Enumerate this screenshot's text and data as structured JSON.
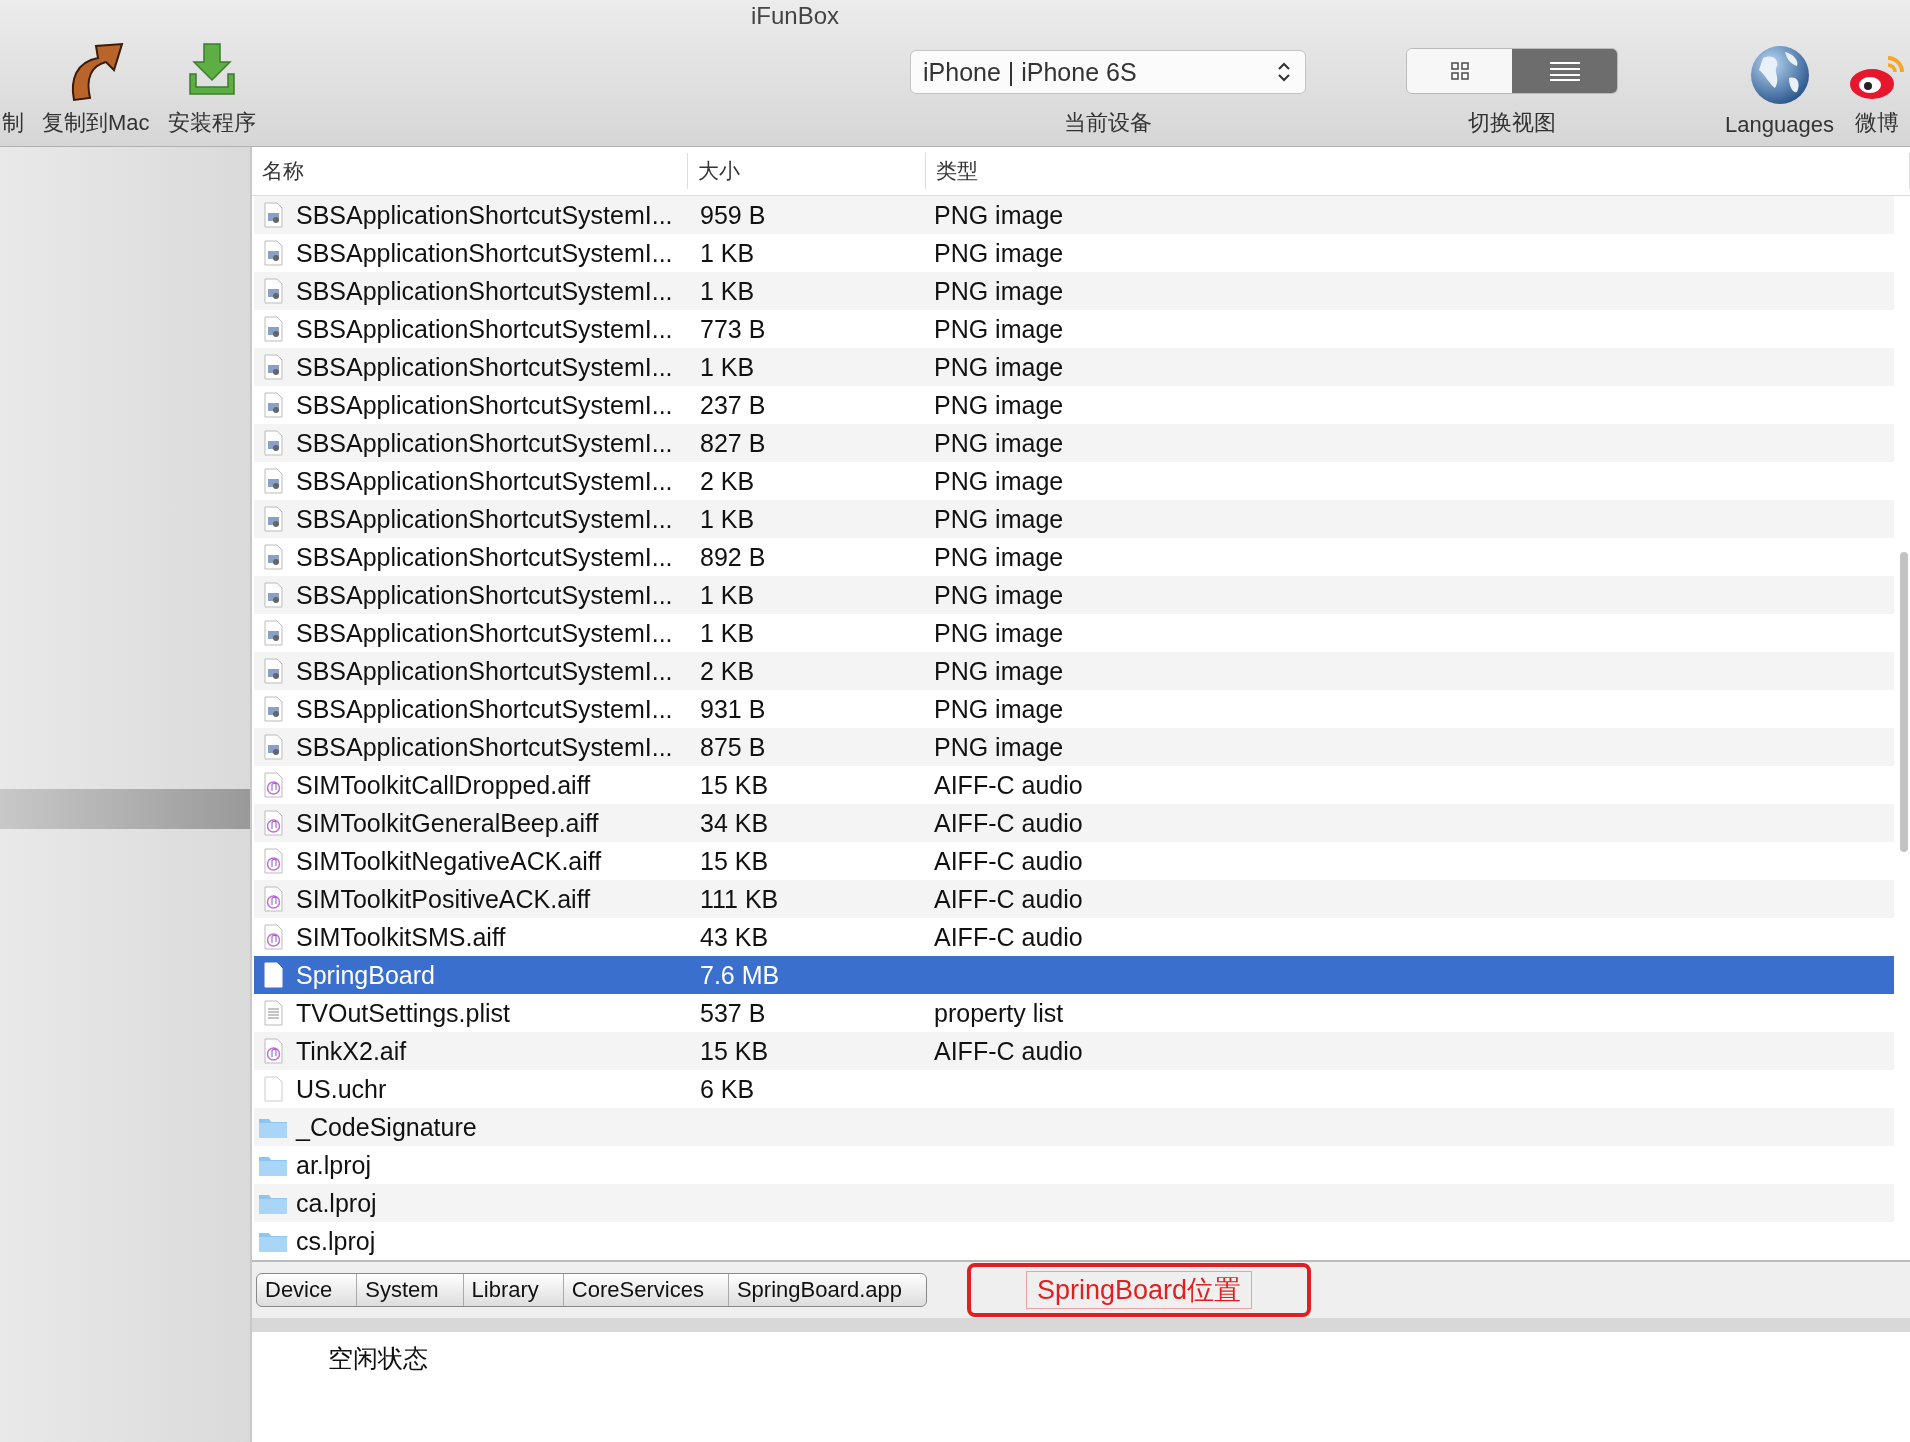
{
  "window": {
    "title": "iFunBox"
  },
  "toolbar": {
    "left_items": [
      {
        "label": "制",
        "kind": "text"
      },
      {
        "label": "复制到Mac",
        "kind": "arrow"
      },
      {
        "label": "安装程序",
        "kind": "install"
      }
    ],
    "device": {
      "value": "iPhone | iPhone 6S",
      "label": "当前设备"
    },
    "view_switch": {
      "label": "切换视图",
      "options": [
        {
          "kind": "grid",
          "selected": false
        },
        {
          "kind": "list",
          "selected": true
        }
      ]
    },
    "right_items": [
      {
        "label": "Languages",
        "kind": "globe"
      },
      {
        "label": "微博",
        "kind": "weibo"
      }
    ]
  },
  "sidebar": {
    "items": [
      {
        "selected": true
      }
    ]
  },
  "table": {
    "columns": [
      "名称",
      "大小",
      "类型"
    ],
    "rows": [
      {
        "kind": "image",
        "name": "SBSApplicationShortcutSystemI...",
        "size": "959 B",
        "type": "PNG image",
        "selected": false
      },
      {
        "kind": "image",
        "name": "SBSApplicationShortcutSystemI...",
        "size": "1 KB",
        "type": "PNG image",
        "selected": false
      },
      {
        "kind": "image",
        "name": "SBSApplicationShortcutSystemI...",
        "size": "1 KB",
        "type": "PNG image",
        "selected": false
      },
      {
        "kind": "image",
        "name": "SBSApplicationShortcutSystemI...",
        "size": "773 B",
        "type": "PNG image",
        "selected": false
      },
      {
        "kind": "image",
        "name": "SBSApplicationShortcutSystemI...",
        "size": "1 KB",
        "type": "PNG image",
        "selected": false
      },
      {
        "kind": "image",
        "name": "SBSApplicationShortcutSystemI...",
        "size": "237 B",
        "type": "PNG image",
        "selected": false
      },
      {
        "kind": "image",
        "name": "SBSApplicationShortcutSystemI...",
        "size": "827 B",
        "type": "PNG image",
        "selected": false
      },
      {
        "kind": "image",
        "name": "SBSApplicationShortcutSystemI...",
        "size": "2 KB",
        "type": "PNG image",
        "selected": false
      },
      {
        "kind": "image",
        "name": "SBSApplicationShortcutSystemI...",
        "size": "1 KB",
        "type": "PNG image",
        "selected": false
      },
      {
        "kind": "image",
        "name": "SBSApplicationShortcutSystemI...",
        "size": "892 B",
        "type": "PNG image",
        "selected": false
      },
      {
        "kind": "image",
        "name": "SBSApplicationShortcutSystemI...",
        "size": "1 KB",
        "type": "PNG image",
        "selected": false
      },
      {
        "kind": "image",
        "name": "SBSApplicationShortcutSystemI...",
        "size": "1 KB",
        "type": "PNG image",
        "selected": false
      },
      {
        "kind": "image",
        "name": "SBSApplicationShortcutSystemI...",
        "size": "2 KB",
        "type": "PNG image",
        "selected": false
      },
      {
        "kind": "image",
        "name": "SBSApplicationShortcutSystemI...",
        "size": "931 B",
        "type": "PNG image",
        "selected": false
      },
      {
        "kind": "image",
        "name": "SBSApplicationShortcutSystemI...",
        "size": "875 B",
        "type": "PNG image",
        "selected": false
      },
      {
        "kind": "audio",
        "name": "SIMToolkitCallDropped.aiff",
        "size": "15 KB",
        "type": "AIFF-C audio",
        "selected": false
      },
      {
        "kind": "audio",
        "name": "SIMToolkitGeneralBeep.aiff",
        "size": "34 KB",
        "type": "AIFF-C audio",
        "selected": false
      },
      {
        "kind": "audio",
        "name": "SIMToolkitNegativeACK.aiff",
        "size": "15 KB",
        "type": "AIFF-C audio",
        "selected": false
      },
      {
        "kind": "audio",
        "name": "SIMToolkitPositiveACK.aiff",
        "size": "111 KB",
        "type": "AIFF-C audio",
        "selected": false
      },
      {
        "kind": "audio",
        "name": "SIMToolkitSMS.aiff",
        "size": "43 KB",
        "type": "AIFF-C audio",
        "selected": false
      },
      {
        "kind": "file",
        "name": "SpringBoard",
        "size": "7.6 MB",
        "selected": true
      },
      {
        "kind": "plist",
        "name": "TVOutSettings.plist",
        "size": "537 B",
        "type": "property list",
        "selected": false
      },
      {
        "kind": "audio",
        "name": "TinkX2.aif",
        "size": "15 KB",
        "type": "AIFF-C audio",
        "selected": false
      },
      {
        "kind": "file",
        "name": "US.uchr",
        "size": "6 KB",
        "selected": false
      },
      {
        "kind": "folder",
        "name": "_CodeSignature",
        "selected": false
      },
      {
        "kind": "folder",
        "name": "ar.lproj",
        "selected": false
      },
      {
        "kind": "folder",
        "name": "ca.lproj",
        "selected": false
      },
      {
        "kind": "folder",
        "name": "cs.lproj",
        "selected": false
      }
    ]
  },
  "breadcrumb": [
    "Device",
    "System",
    "Library",
    "CoreServices",
    "SpringBoard.app"
  ],
  "annotation": {
    "text": "SpringBoard位置"
  },
  "status_bar": {
    "text": "空闲状态"
  }
}
